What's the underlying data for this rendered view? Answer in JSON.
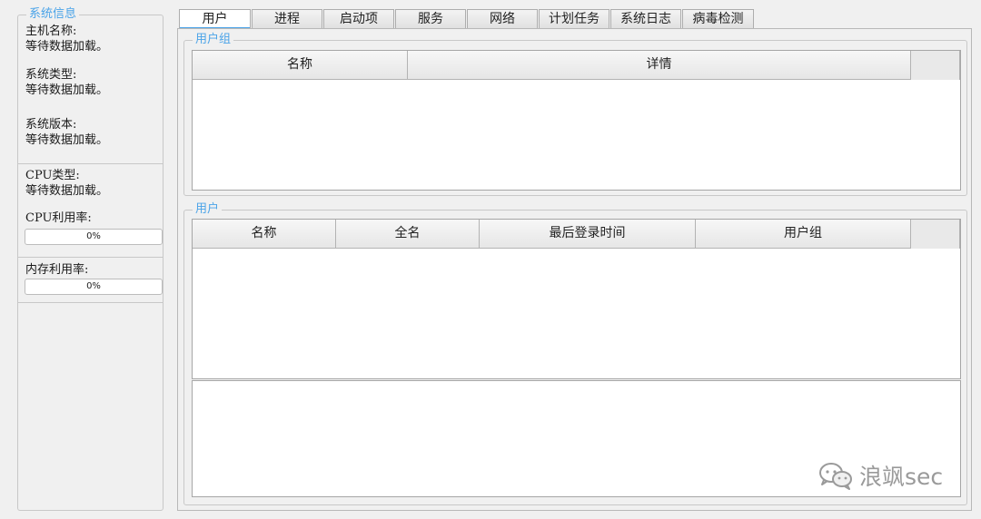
{
  "system_info": {
    "title": "系统信息",
    "host_name_label": "主机名称:",
    "host_name_value": "等待数据加载。",
    "os_type_label": "系统类型:",
    "os_type_value": "等待数据加载。",
    "os_version_label": "系统版本:",
    "os_version_value": "等待数据加载。",
    "cpu_type_label": "CPU类型:",
    "cpu_type_value": "等待数据加载。",
    "cpu_usage_label": "CPU利用率:",
    "cpu_usage_percent": 0,
    "cpu_usage_text": "0%",
    "memory_usage_label": "内存利用率:",
    "memory_usage_percent": 0,
    "memory_usage_text": "0%"
  },
  "tabs": [
    {
      "label": "用户",
      "active": true
    },
    {
      "label": "进程",
      "active": false
    },
    {
      "label": "启动项",
      "active": false
    },
    {
      "label": "服务",
      "active": false
    },
    {
      "label": "网络",
      "active": false
    },
    {
      "label": "计划任务",
      "active": false
    },
    {
      "label": "系统日志",
      "active": false
    },
    {
      "label": "病毒检测",
      "active": false
    }
  ],
  "user_groups": {
    "title": "用户组",
    "columns": [
      "名称",
      "详情"
    ],
    "rows": []
  },
  "users": {
    "title": "用户",
    "columns": [
      "名称",
      "全名",
      "最后登录时间",
      "用户组"
    ],
    "rows": [],
    "detail_text": ""
  },
  "watermark": {
    "text": "浪飒sec",
    "icon": "wechat-icon"
  },
  "colors": {
    "accent": "#4aa3e8",
    "background": "#f0f0f0",
    "progress_fill": "#06b025"
  }
}
